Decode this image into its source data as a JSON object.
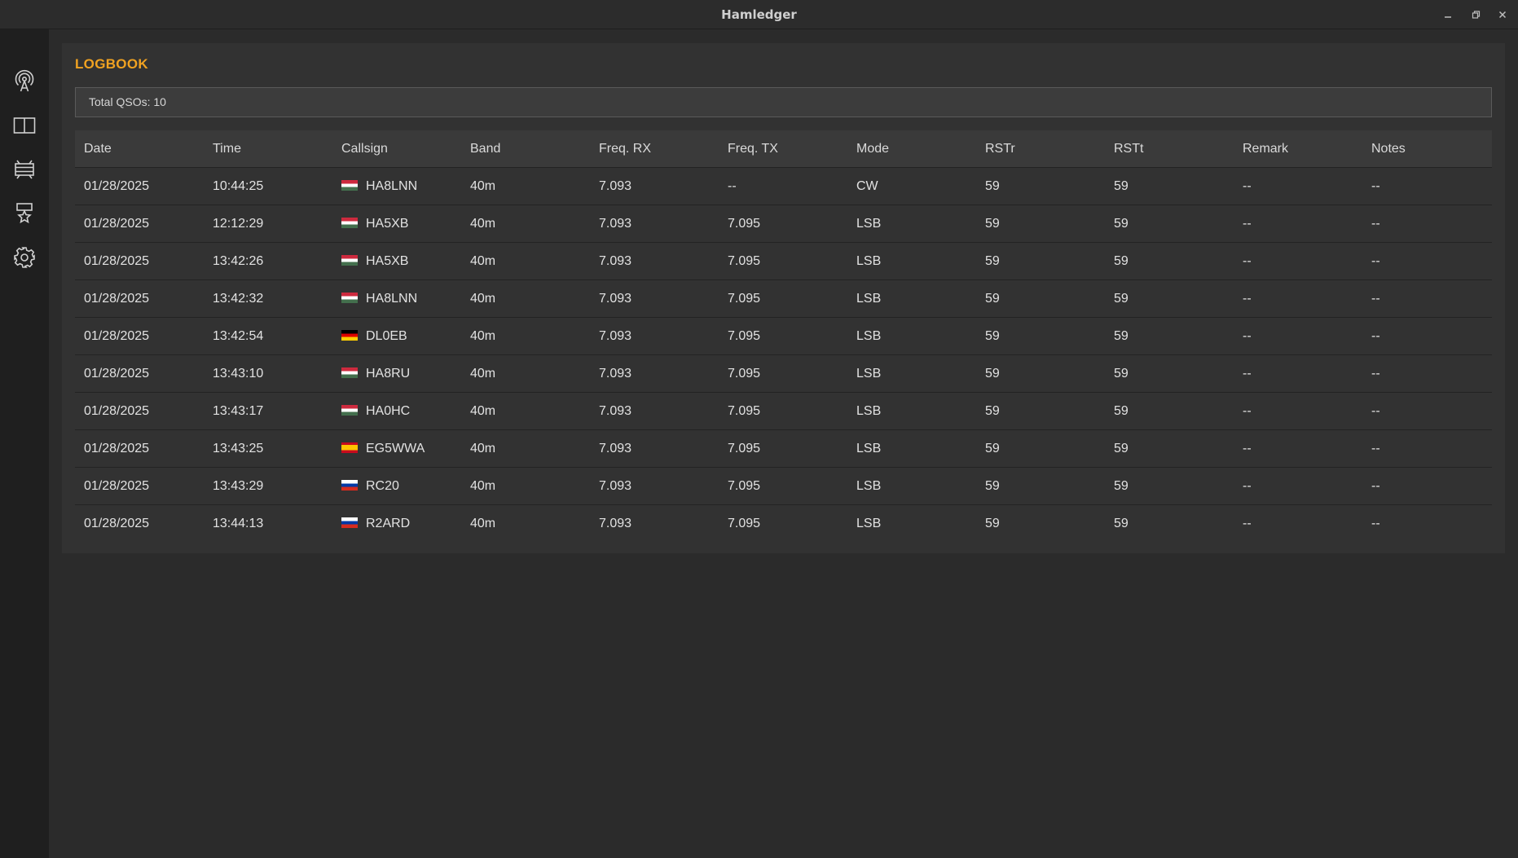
{
  "window": {
    "title": "Hamledger"
  },
  "sidebar": {
    "items": [
      {
        "icon": "antenna-icon"
      },
      {
        "icon": "logbook-icon"
      },
      {
        "icon": "cluster-icon"
      },
      {
        "icon": "award-icon"
      },
      {
        "icon": "settings-icon"
      }
    ]
  },
  "logbook": {
    "heading": "LOGBOOK",
    "total": "Total QSOs: 10",
    "columns": [
      "Date",
      "Time",
      "Callsign",
      "Band",
      "Freq. RX",
      "Freq. TX",
      "Mode",
      "RSTr",
      "RSTt",
      "Remark",
      "Notes"
    ],
    "rows": [
      {
        "date": "01/28/2025",
        "time": "10:44:25",
        "flag": "HU",
        "callsign": "HA8LNN",
        "band": "40m",
        "freq_rx": "7.093",
        "freq_tx": "--",
        "mode": "CW",
        "rstr": "59",
        "rstt": "59",
        "remark": "--",
        "notes": "--"
      },
      {
        "date": "01/28/2025",
        "time": "12:12:29",
        "flag": "HU",
        "callsign": "HA5XB",
        "band": "40m",
        "freq_rx": "7.093",
        "freq_tx": "7.095",
        "mode": "LSB",
        "rstr": "59",
        "rstt": "59",
        "remark": "--",
        "notes": "--"
      },
      {
        "date": "01/28/2025",
        "time": "13:42:26",
        "flag": "HU",
        "callsign": "HA5XB",
        "band": "40m",
        "freq_rx": "7.093",
        "freq_tx": "7.095",
        "mode": "LSB",
        "rstr": "59",
        "rstt": "59",
        "remark": "--",
        "notes": "--"
      },
      {
        "date": "01/28/2025",
        "time": "13:42:32",
        "flag": "HU",
        "callsign": "HA8LNN",
        "band": "40m",
        "freq_rx": "7.093",
        "freq_tx": "7.095",
        "mode": "LSB",
        "rstr": "59",
        "rstt": "59",
        "remark": "--",
        "notes": "--"
      },
      {
        "date": "01/28/2025",
        "time": "13:42:54",
        "flag": "DE",
        "callsign": "DL0EB",
        "band": "40m",
        "freq_rx": "7.093",
        "freq_tx": "7.095",
        "mode": "LSB",
        "rstr": "59",
        "rstt": "59",
        "remark": "--",
        "notes": "--"
      },
      {
        "date": "01/28/2025",
        "time": "13:43:10",
        "flag": "HU",
        "callsign": "HA8RU",
        "band": "40m",
        "freq_rx": "7.093",
        "freq_tx": "7.095",
        "mode": "LSB",
        "rstr": "59",
        "rstt": "59",
        "remark": "--",
        "notes": "--"
      },
      {
        "date": "01/28/2025",
        "time": "13:43:17",
        "flag": "HU",
        "callsign": "HA0HC",
        "band": "40m",
        "freq_rx": "7.093",
        "freq_tx": "7.095",
        "mode": "LSB",
        "rstr": "59",
        "rstt": "59",
        "remark": "--",
        "notes": "--"
      },
      {
        "date": "01/28/2025",
        "time": "13:43:25",
        "flag": "ES",
        "callsign": "EG5WWA",
        "band": "40m",
        "freq_rx": "7.093",
        "freq_tx": "7.095",
        "mode": "LSB",
        "rstr": "59",
        "rstt": "59",
        "remark": "--",
        "notes": "--"
      },
      {
        "date": "01/28/2025",
        "time": "13:43:29",
        "flag": "RU",
        "callsign": "RC20",
        "band": "40m",
        "freq_rx": "7.093",
        "freq_tx": "7.095",
        "mode": "LSB",
        "rstr": "59",
        "rstt": "59",
        "remark": "--",
        "notes": "--"
      },
      {
        "date": "01/28/2025",
        "time": "13:44:13",
        "flag": "RU",
        "callsign": "R2ARD",
        "band": "40m",
        "freq_rx": "7.093",
        "freq_tx": "7.095",
        "mode": "LSB",
        "rstr": "59",
        "rstt": "59",
        "remark": "--",
        "notes": "--"
      }
    ]
  },
  "colors": {
    "accent": "#f0a221",
    "background": "#2b2b2b",
    "panel": "#323232",
    "sidebar": "#1f1f1f"
  }
}
